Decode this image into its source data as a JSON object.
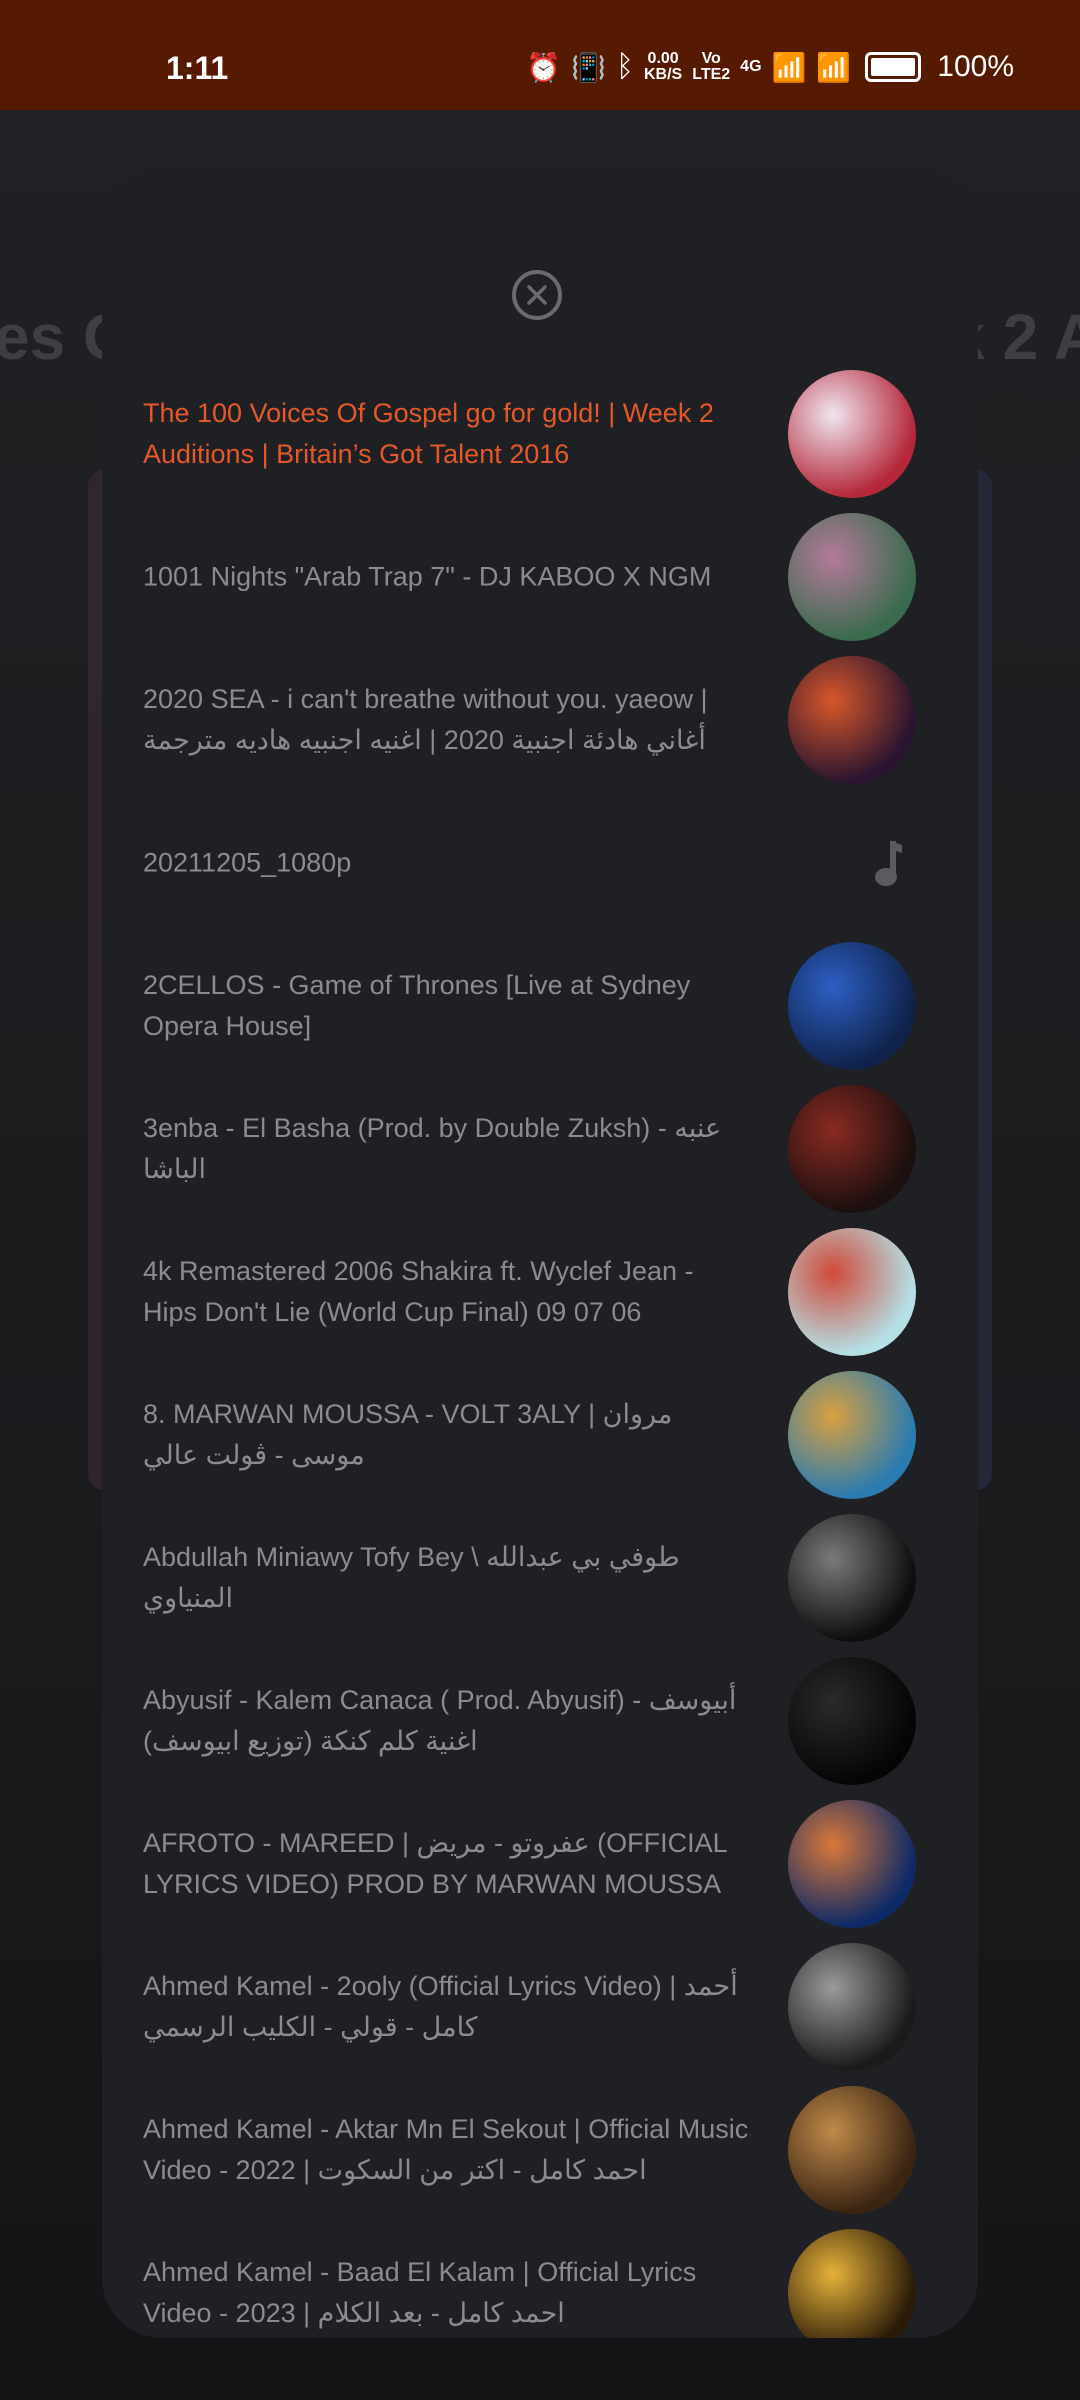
{
  "status": {
    "time": "1:11",
    "net_speed_top": "0.00",
    "net_speed_unit": "KB/S",
    "volte_top": "Vo",
    "volte_bottom": "LTE2",
    "network": "4G",
    "battery": "100%"
  },
  "background": {
    "title_left": "es G",
    "title_right": "k 2 A"
  },
  "playlist": {
    "items": [
      {
        "title": "The 100 Voices Of Gospel go for gold! | Week 2 Auditions | Britain’s Got Talent 2016",
        "active": true,
        "thumb": "thumb-1",
        "colors": [
          "#b4283a",
          "#f0e6f0"
        ]
      },
      {
        "title": "1001 Nights \"Arab Trap 7\" - DJ KABOO X NGM",
        "active": false,
        "thumb": "thumb-2",
        "colors": [
          "#3a6b4e",
          "#b57a9a"
        ]
      },
      {
        "title": "2020 SEA - i can't breathe without you. yaeow | أغاني هادئة اجنبية 2020 | اغنيه اجنبيه هاديه مترجمة",
        "active": false,
        "thumb": "thumb-3",
        "colors": [
          "#2a1430",
          "#d7572a"
        ]
      },
      {
        "title": "20211205_1080p",
        "active": false,
        "thumb": "music-note-icon",
        "colors": [
          "#5a5b60",
          "#5a5b60"
        ]
      },
      {
        "title": "2CELLOS - Game of Thrones [Live at Sydney Opera House]",
        "active": false,
        "thumb": "thumb-5",
        "colors": [
          "#10224a",
          "#2c5fc4"
        ]
      },
      {
        "title": "3enba - El Basha (Prod. by Double Zuksh) عنبه - الباشا",
        "active": false,
        "thumb": "thumb-6",
        "colors": [
          "#1b0f0f",
          "#8a2a22"
        ]
      },
      {
        "title": "4k Remastered 2006 Shakira ft. Wyclef Jean - Hips Don't Lie (World Cup Final) 09 07 06",
        "active": false,
        "thumb": "thumb-7",
        "colors": [
          "#b5e0e6",
          "#d04a3a"
        ]
      },
      {
        "title": "8. MARWAN MOUSSA - VOLT 3ALY | مروان موسى - ڤولت عالي",
        "active": false,
        "thumb": "thumb-8",
        "colors": [
          "#2a7bb0",
          "#d9a040"
        ]
      },
      {
        "title": "Abdullah Miniawy Tofy Bey \\ طوفي بي عبدالله المنياوي",
        "active": false,
        "thumb": "thumb-9",
        "colors": [
          "#0e0e0e",
          "#7a7a7a"
        ]
      },
      {
        "title": "Abyusif - Kalem Canaca ( Prod. Abyusif) أبيوسف - اغنية كلم كنكة (توزيع ابيوسف)",
        "active": false,
        "thumb": "thumb-10",
        "colors": [
          "#050505",
          "#2a2a2a"
        ]
      },
      {
        "title": "AFROTO - MAREED | عفروتو - مريض (OFFICIAL LYRICS VIDEO) PROD BY MARWAN MOUSSA",
        "active": false,
        "thumb": "thumb-11",
        "colors": [
          "#0e2a66",
          "#d9783a"
        ]
      },
      {
        "title": "Ahmed Kamel - 2ooly (Official Lyrics Video) | أحمد كامل - قولي - الكليب الرسمي",
        "active": false,
        "thumb": "thumb-12",
        "colors": [
          "#1a1a1a",
          "#9a9a9a"
        ]
      },
      {
        "title": "Ahmed Kamel - Aktar Mn El Sekout | Official Music Video - 2022 | احمد كامل - اكتر من السكوت",
        "active": false,
        "thumb": "thumb-13",
        "colors": [
          "#3a2412",
          "#c08a4a"
        ]
      },
      {
        "title": "Ahmed Kamel - Baad El Kalam | Official Lyrics Video - 2023 | احمد كامل - بعد الكلام",
        "active": false,
        "thumb": "thumb-14",
        "colors": [
          "#2a1a08",
          "#e6b23a"
        ]
      }
    ]
  }
}
